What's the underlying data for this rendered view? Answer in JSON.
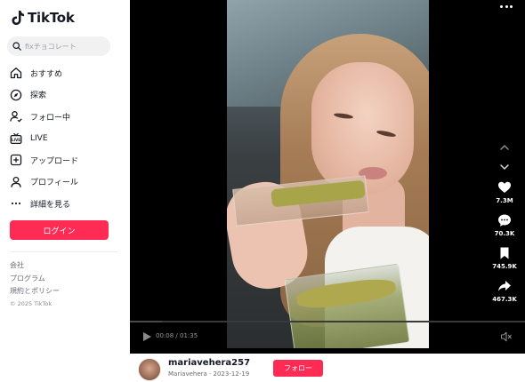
{
  "brand": {
    "name": "TikTok",
    "accent": "#fe2c55"
  },
  "search": {
    "placeholder": "fixチョコレート"
  },
  "sidebar": {
    "items": [
      {
        "label": "おすすめ",
        "icon": "home-icon"
      },
      {
        "label": "探索",
        "icon": "compass-icon"
      },
      {
        "label": "フォロー中",
        "icon": "user-follow-icon"
      },
      {
        "label": "LIVE",
        "icon": "live-tv-icon"
      },
      {
        "label": "アップロード",
        "icon": "upload-plus-icon"
      },
      {
        "label": "プロフィール",
        "icon": "profile-icon"
      },
      {
        "label": "詳細を見る",
        "icon": "more-dots-icon"
      }
    ],
    "login_label": "ログイン"
  },
  "footer": {
    "links": [
      "会社",
      "プログラム",
      "規約とポリシー"
    ],
    "copyright": "© 2025 TikTok"
  },
  "player": {
    "current_time": "00:08",
    "duration": "01:35",
    "progress": 0.08
  },
  "actions": {
    "likes": "7.3M",
    "comments": "70.3K",
    "saves": "745.9K",
    "shares": "467.3K"
  },
  "author": {
    "username": "mariavehera257",
    "display_name": "Mariavehera",
    "date": "2023-12-19",
    "follow_label": "フォロー"
  }
}
